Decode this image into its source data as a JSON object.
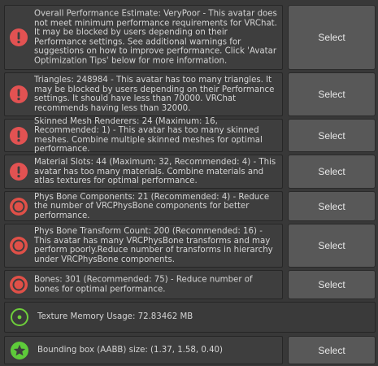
{
  "messages": [
    {
      "icon": "error",
      "text": "Overall Performance Estimate: VeryPoor - This avatar does not meet minimum performance requirements for VRChat. It may be blocked by users depending on their Performance settings. See additional warnings for suggestions on how to improve performance. Click 'Avatar Optimization Tips' below for more information.",
      "button": "Select"
    },
    {
      "icon": "error",
      "text": "Triangles: 248984 - This avatar has too many triangles. It may be blocked by users depending on their Performance settings. It should have less than 70000. VRChat recommends having less than 32000.",
      "button": "Select"
    },
    {
      "icon": "error",
      "text": "Skinned Mesh Renderers: 24 (Maximum: 16, Recommended: 1) - This avatar has too many skinned meshes. Combine multiple skinned meshes for optimal performance.",
      "button": "Select"
    },
    {
      "icon": "error",
      "text": "Material Slots: 44 (Maximum: 32, Recommended: 4) - This avatar has too many materials. Combine materials and atlas textures for optimal performance.",
      "button": "Select"
    },
    {
      "icon": "poor",
      "text": "Phys Bone Components: 21 (Recommended: 4) - Reduce the number of VRCPhysBone components for better performance.",
      "button": "Select"
    },
    {
      "icon": "poor",
      "text": "Phys Bone Transform Count: 200 (Recommended: 16) - This avatar has many VRCPhysBone transforms and may perform poorly.Reduce number of transforms in hierarchy under VRCPhysBone components.",
      "button": "Select"
    },
    {
      "icon": "poor",
      "text": "Bones: 301 (Recommended: 75) - Reduce number of bones for optimal performance.",
      "button": "Select"
    },
    {
      "icon": "good",
      "text": "Texture Memory Usage: 72.83462 MB",
      "button": ""
    },
    {
      "icon": "excellent",
      "text": "Bounding box (AABB) size: (1.37, 1.58, 0.40)",
      "button": "Select"
    }
  ],
  "colors": {
    "error_red": "#e25252",
    "poor_red": "#e05048",
    "good_green": "#6ecf3a",
    "excellent_green": "#5ecb3a"
  }
}
